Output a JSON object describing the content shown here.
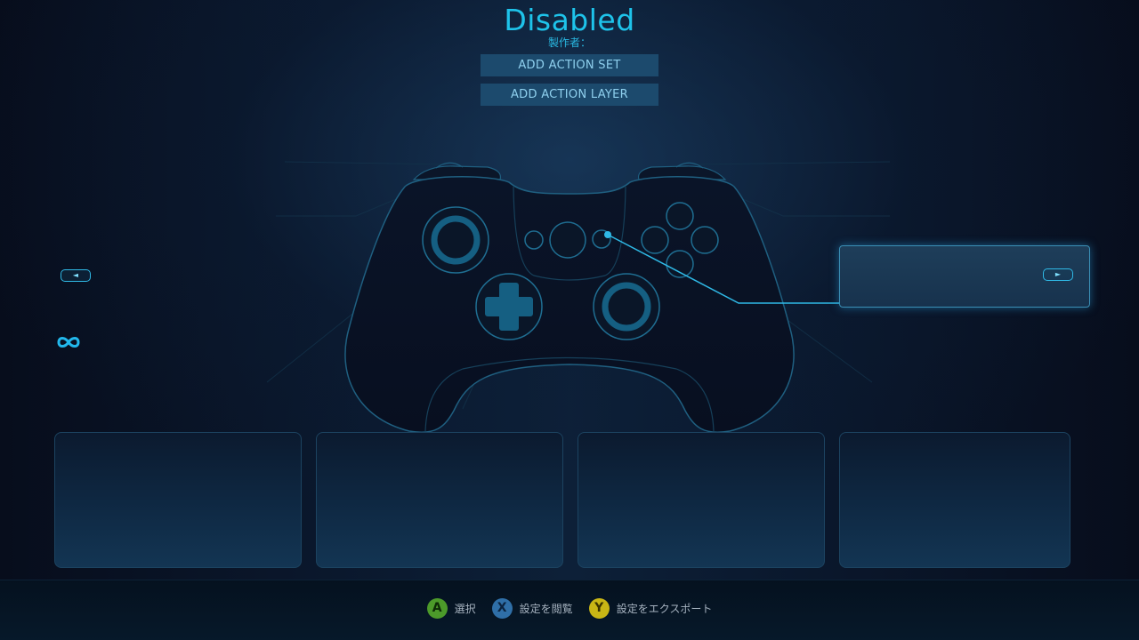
{
  "header": {
    "title": "Disabled",
    "author_label": "製作者："
  },
  "actions": {
    "add_action_set": "ADD ACTION SET",
    "add_action_layer": "ADD ACTION LAYER"
  },
  "navigation": {
    "prev_icon": "left-arrow-icon",
    "next_icon": "right-arrow-icon",
    "loop_icon": "infinity-icon"
  },
  "footer": {
    "hints": [
      {
        "button": "A",
        "label": "選択"
      },
      {
        "button": "X",
        "label": "設定を閲覧"
      },
      {
        "button": "Y",
        "label": "設定をエクスポート"
      }
    ]
  },
  "colors": {
    "accent": "#1ec3ea",
    "button_bg": "#1c4a6d",
    "controller_outline": "#1f5f80",
    "badge_a": "#4c9a2a",
    "badge_x": "#2f6fa8",
    "badge_y": "#c9b615"
  }
}
